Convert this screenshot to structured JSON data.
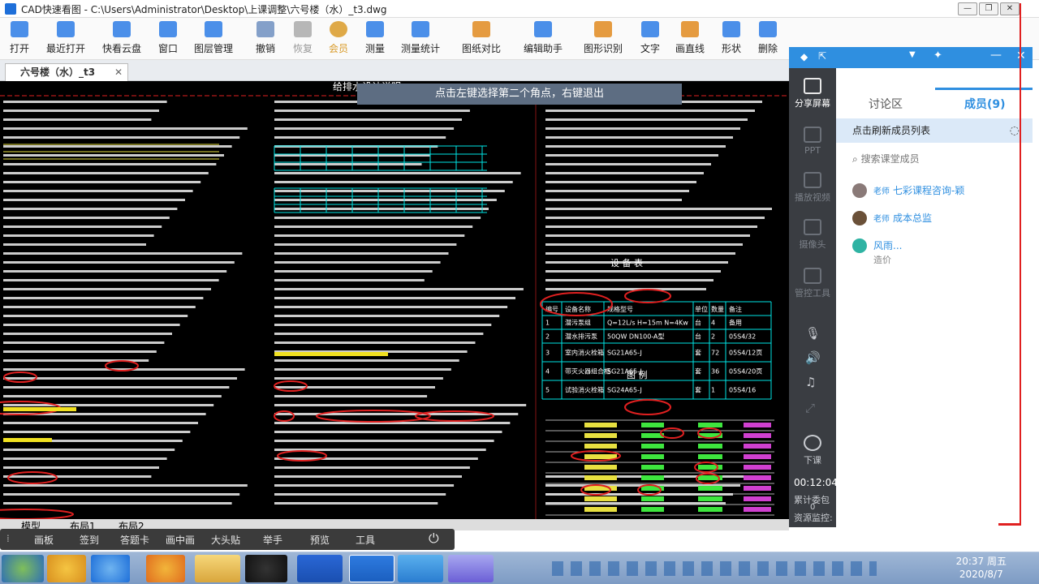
{
  "window": {
    "title": "CAD快速看图 - C:\\Users\\Administrator\\Desktop\\上课调整\\六号楼（水）_t3.dwg",
    "controls": [
      "—",
      "❐",
      "✕"
    ]
  },
  "toolbar": {
    "items": [
      {
        "label": "打开",
        "icon": "folder-open-icon",
        "color": "#2c7be5"
      },
      {
        "label": "最近打开",
        "icon": "recent-icon",
        "color": "#2c7be5"
      },
      {
        "label": "快看云盘",
        "icon": "cloud-icon",
        "color": "#2c7be5"
      },
      {
        "label": "窗口",
        "icon": "window-icon",
        "color": "#2c7be5"
      },
      {
        "label": "图层管理",
        "icon": "layers-icon",
        "color": "#2c7be5"
      },
      {
        "label": "撤销",
        "icon": "undo-icon",
        "color": "#6f8fbf"
      },
      {
        "label": "恢复",
        "icon": "redo-icon",
        "color": "#aaaaaa"
      },
      {
        "label": "会员",
        "icon": "vip-icon",
        "color": "#d99a27"
      },
      {
        "label": "测量",
        "icon": "measure-icon",
        "color": "#2c7be5"
      },
      {
        "label": "测量统计",
        "icon": "measure-stats-icon",
        "color": "#2c7be5"
      },
      {
        "label": "图纸对比",
        "icon": "compare-icon",
        "color": "#e08a1e"
      },
      {
        "label": "编辑助手",
        "icon": "edit-assistant-icon",
        "color": "#2c7be5"
      },
      {
        "label": "图形识别",
        "icon": "shape-recognition-icon",
        "color": "#e08a1e"
      },
      {
        "label": "文字",
        "icon": "text-icon",
        "color": "#2c7be5"
      },
      {
        "label": "画直线",
        "icon": "line-icon",
        "color": "#e08a1e"
      },
      {
        "label": "形状",
        "icon": "shape-icon",
        "color": "#2c7be5"
      },
      {
        "label": "删除",
        "icon": "eraser-icon",
        "color": "#2c7be5"
      }
    ]
  },
  "document_tab": {
    "label": "六号楼（水）_t3",
    "close": "✕"
  },
  "hint": "点击左键选择第二个角点，右键退出",
  "layout_tabs": [
    "模型",
    "布局1",
    "布局2"
  ],
  "bottom_bar": {
    "items": [
      "画板",
      "签到",
      "答题卡",
      "画中画",
      "大头贴",
      "举手",
      "预览",
      "工具"
    ]
  },
  "side_tools": [
    {
      "label": "分享屏幕",
      "icon": "share-screen-icon"
    },
    {
      "label": "PPT",
      "icon": "ppt-icon"
    },
    {
      "label": "播放视频",
      "icon": "play-video-icon"
    },
    {
      "label": "摄像头",
      "icon": "camera-icon"
    },
    {
      "label": "管控工具",
      "icon": "control-tools-icon"
    },
    {
      "label": "下课",
      "icon": "end-class-icon"
    }
  ],
  "side_extra": {
    "timer": "00:12:04",
    "gifts_label": "累计委包",
    "gifts_count": "0",
    "monitor_label": "资源监控:"
  },
  "panel": {
    "tabs": [
      "讨论区",
      "成员(9)"
    ],
    "refresh": "点击刷新成员列表",
    "search_placeholder": "搜索课堂成员",
    "members": [
      {
        "role": "老师",
        "name": "七彩课程咨询-颖"
      },
      {
        "role": "老师",
        "name": "成本总监"
      },
      {
        "role": "",
        "name": "风雨...",
        "sub": "造价"
      }
    ]
  },
  "drawing": {
    "title": "给排水设计说明",
    "equipment_table_title": "设 备 表",
    "legend_title": "图 例",
    "equipment_headers": [
      "编号",
      "设备名称",
      "规格型号",
      "单位",
      "数量",
      "备注"
    ],
    "equipment_rows": [
      [
        "1",
        "潜污泵组",
        "Q=12L/s  H=15m  N=4Kw",
        "台",
        "4",
        "备用"
      ],
      [
        "2",
        "潜水排污泵",
        "50QW DN100-A型",
        "台",
        "2",
        "05S4/32"
      ],
      [
        "3",
        "室内消火栓箱",
        "SG21A65-J",
        "套",
        "72",
        "05S4/12页"
      ],
      [
        "4",
        "带灭火器组合柜",
        "SG21A65-J",
        "套",
        "36",
        "05S4/20页"
      ],
      [
        "5",
        "试验消火栓箱",
        "SG24A65-J",
        "套",
        "1",
        "05S4/16"
      ]
    ]
  },
  "tray": {
    "time": "20:37 周五",
    "date": "2020/8/7"
  },
  "taskbar_apps": [
    "start",
    "app-1",
    "ie",
    "app-2",
    "explorer",
    "qq",
    "wps",
    "cad",
    "app-3",
    "app-4"
  ]
}
